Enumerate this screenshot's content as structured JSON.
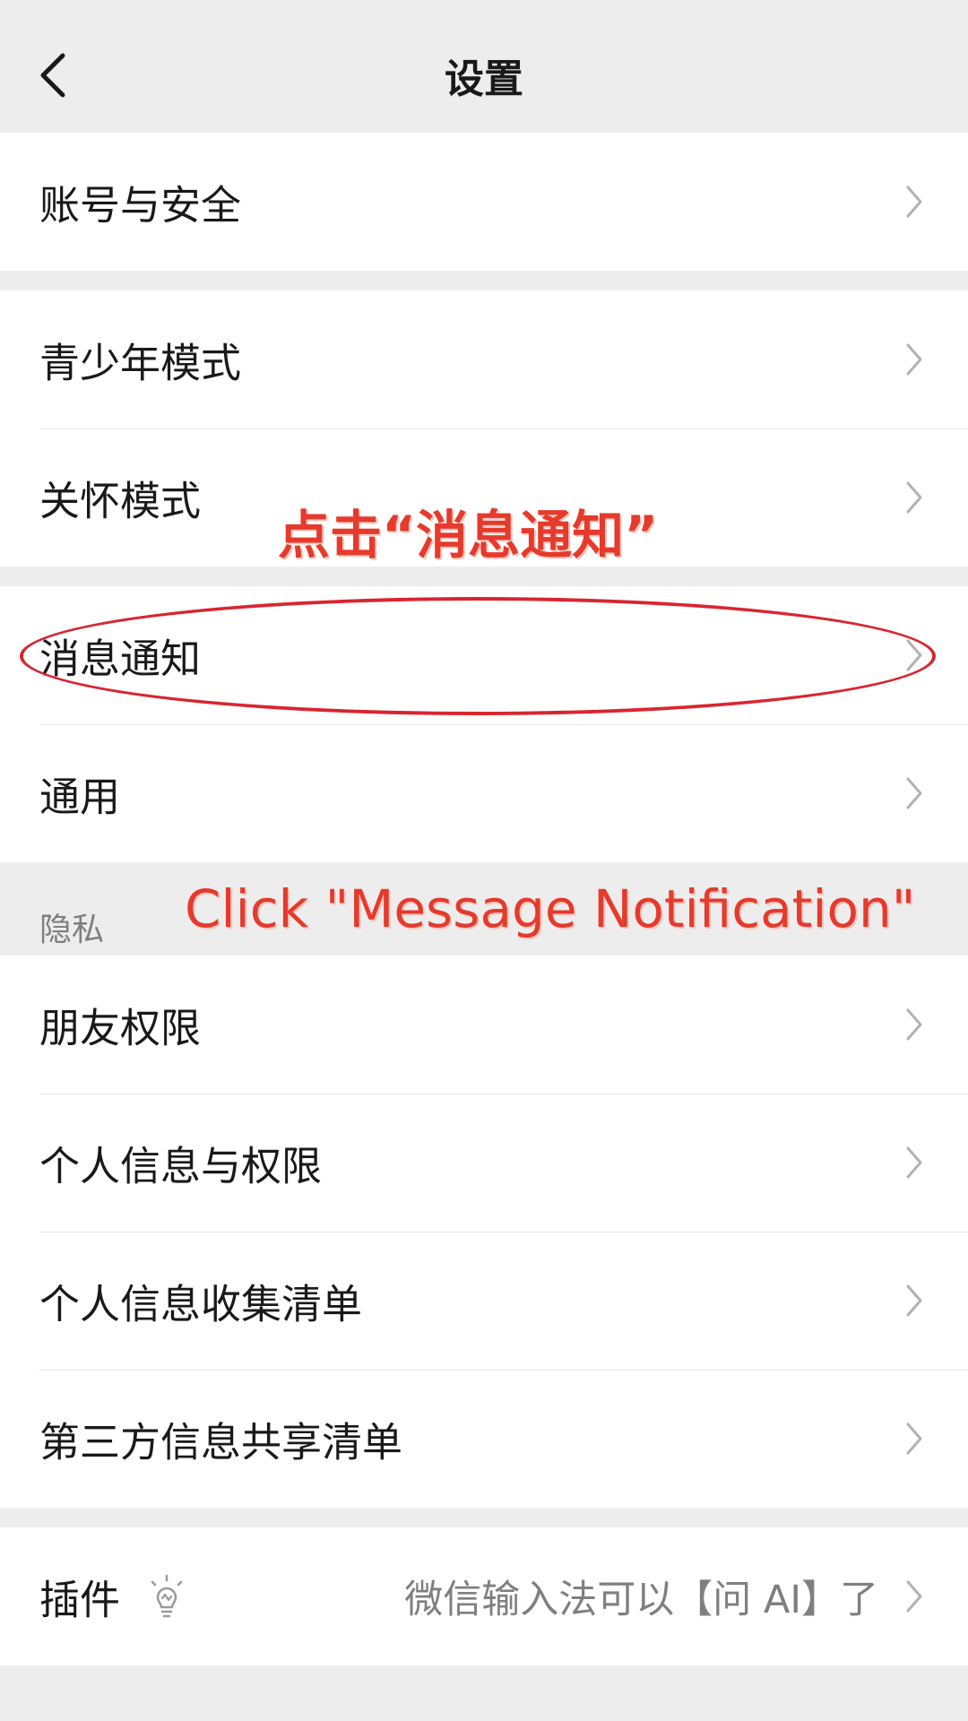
{
  "header": {
    "title": "设置",
    "back_icon": "chevron-left-icon"
  },
  "groups": {
    "account": {
      "items": [
        {
          "label": "账号与安全"
        }
      ]
    },
    "modes": {
      "items": [
        {
          "label": "青少年模式"
        },
        {
          "label": "关怀模式"
        }
      ]
    },
    "general": {
      "items": [
        {
          "label": "消息通知"
        },
        {
          "label": "通用"
        }
      ]
    },
    "privacy": {
      "section_label": "隐私",
      "items": [
        {
          "label": "朋友权限"
        },
        {
          "label": "个人信息与权限"
        },
        {
          "label": "个人信息收集清单"
        },
        {
          "label": "第三方信息共享清单"
        }
      ]
    },
    "plugins": {
      "label": "插件",
      "icon": "lightbulb-icon",
      "hint": "微信输入法可以【问 AI】了"
    }
  },
  "annotations": {
    "chinese": "点击“消息通知”",
    "english": "Click \"Message Notification\"",
    "color": "#e53a2c"
  },
  "colors": {
    "background": "#ededed",
    "card": "#ffffff",
    "text": "#191919",
    "secondary_text": "#7f7f7f"
  }
}
